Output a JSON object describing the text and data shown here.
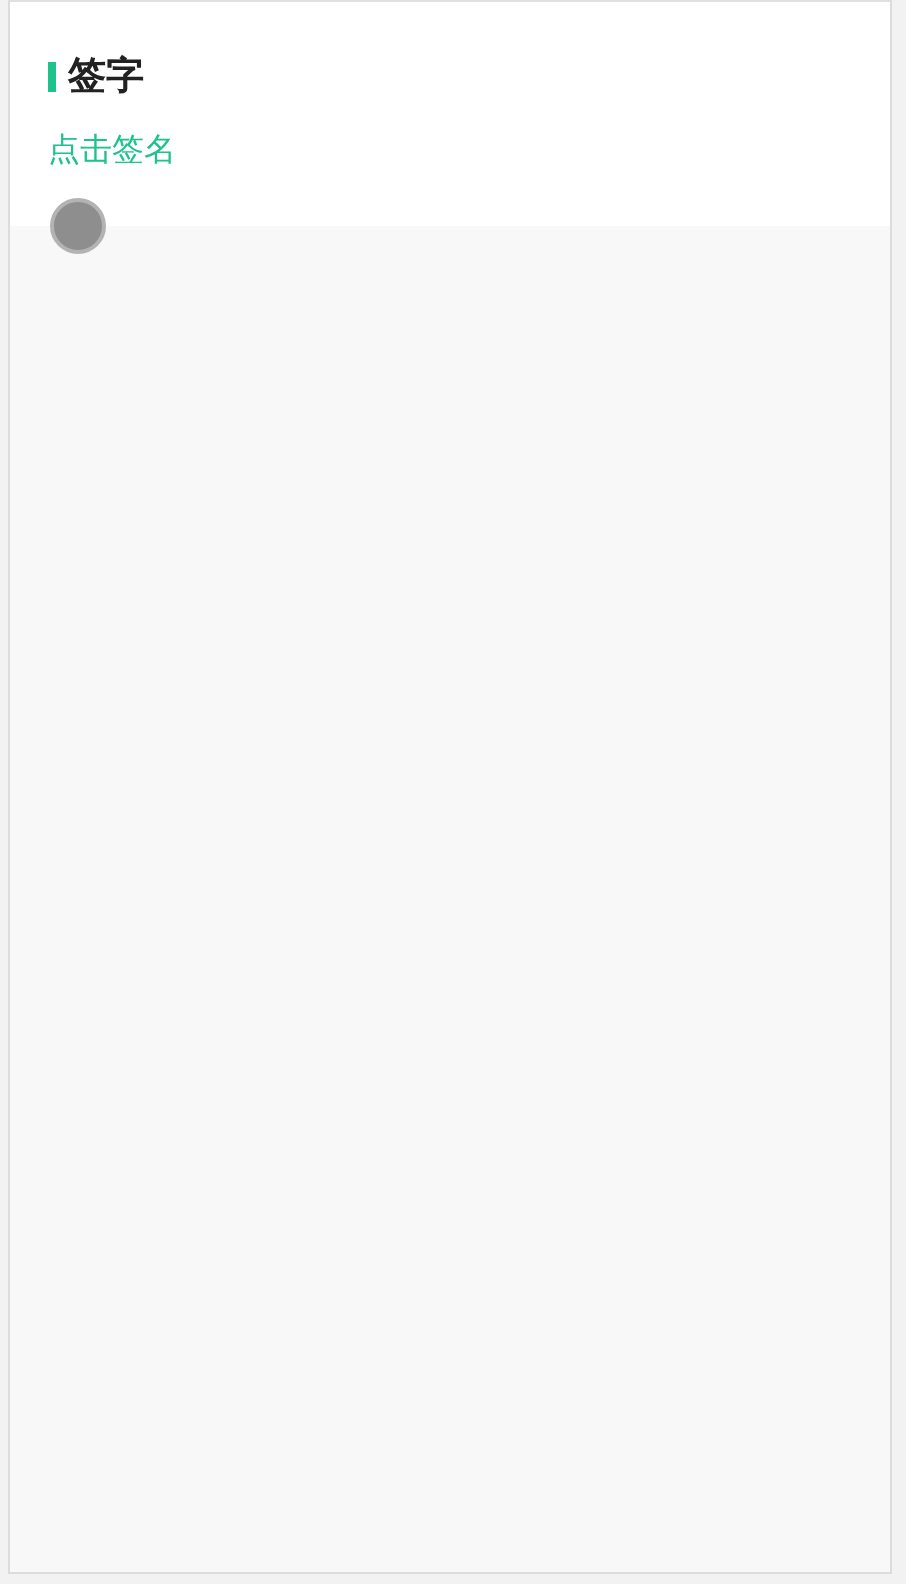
{
  "section": {
    "title": "签字"
  },
  "signature_link": {
    "label": "点击签名"
  }
}
